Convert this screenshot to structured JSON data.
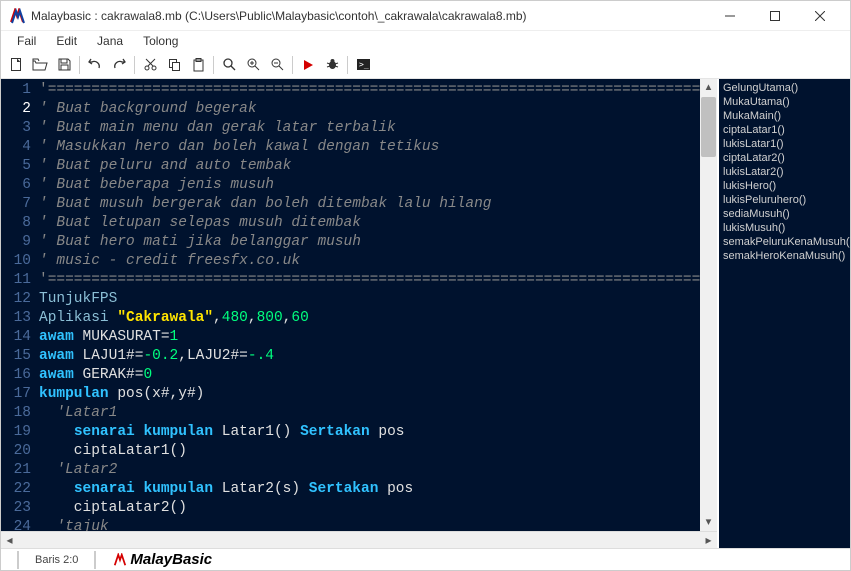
{
  "window": {
    "title": "Malaybasic :  cakrawala8.mb  (C:\\Users\\Public\\Malaybasic\\contoh\\_cakrawala\\cakrawala8.mb)"
  },
  "menu": {
    "items": [
      "Fail",
      "Edit",
      "Jana",
      "Tolong"
    ]
  },
  "toolbar": {
    "groups": [
      [
        "new-file",
        "open-file",
        "save-file"
      ],
      [
        "undo",
        "redo"
      ],
      [
        "cut",
        "copy",
        "paste"
      ],
      [
        "find",
        "zoom-in",
        "zoom-out"
      ],
      [
        "run",
        "debug"
      ],
      [
        "terminal"
      ]
    ]
  },
  "code": {
    "lines": [
      {
        "tokens": [
          {
            "t": "cm-comment-sep",
            "v": "'============================================================================"
          }
        ]
      },
      {
        "tokens": [
          {
            "t": "cm-comment",
            "v": "' Buat background begerak"
          }
        ]
      },
      {
        "tokens": [
          {
            "t": "cm-comment",
            "v": "' Buat main menu dan gerak latar terbalik"
          }
        ]
      },
      {
        "tokens": [
          {
            "t": "cm-comment",
            "v": "' Masukkan hero dan boleh kawal dengan tetikus"
          }
        ]
      },
      {
        "tokens": [
          {
            "t": "cm-comment",
            "v": "' Buat peluru and auto tembak"
          }
        ]
      },
      {
        "tokens": [
          {
            "t": "cm-comment",
            "v": "' Buat beberapa jenis musuh"
          }
        ]
      },
      {
        "tokens": [
          {
            "t": "cm-comment",
            "v": "' Buat musuh bergerak dan boleh ditembak lalu hilang"
          }
        ]
      },
      {
        "tokens": [
          {
            "t": "cm-comment",
            "v": "' Buat letupan selepas musuh ditembak"
          }
        ]
      },
      {
        "tokens": [
          {
            "t": "cm-comment",
            "v": "' Buat hero mati jika belanggar musuh"
          }
        ]
      },
      {
        "tokens": [
          {
            "t": "cm-comment",
            "v": "' music - credit freesfx.co.uk"
          }
        ]
      },
      {
        "tokens": [
          {
            "t": "cm-comment-sep",
            "v": "'============================================================================"
          }
        ]
      },
      {
        "tokens": [
          {
            "t": "cm-pale",
            "v": "TunjukFPS"
          }
        ]
      },
      {
        "tokens": [
          {
            "t": "cm-pale",
            "v": "Aplikasi "
          },
          {
            "t": "cm-string",
            "v": "\"Cakrawala\""
          },
          {
            "t": "cm-ident",
            "v": ","
          },
          {
            "t": "cm-number",
            "v": "480"
          },
          {
            "t": "cm-ident",
            "v": ","
          },
          {
            "t": "cm-number",
            "v": "800"
          },
          {
            "t": "cm-ident",
            "v": ","
          },
          {
            "t": "cm-number",
            "v": "60"
          }
        ]
      },
      {
        "tokens": [
          {
            "t": "cm-keyword",
            "v": "awam"
          },
          {
            "t": "cm-ident",
            "v": " MUKASURAT"
          },
          {
            "t": "cm-op",
            "v": "="
          },
          {
            "t": "cm-number",
            "v": "1"
          }
        ]
      },
      {
        "tokens": [
          {
            "t": "cm-keyword",
            "v": "awam"
          },
          {
            "t": "cm-ident",
            "v": " LAJU1#"
          },
          {
            "t": "cm-op",
            "v": "="
          },
          {
            "t": "cm-number",
            "v": "-0.2"
          },
          {
            "t": "cm-ident",
            "v": ",LAJU2#"
          },
          {
            "t": "cm-op",
            "v": "="
          },
          {
            "t": "cm-number",
            "v": "-.4"
          }
        ]
      },
      {
        "tokens": [
          {
            "t": "cm-keyword",
            "v": "awam"
          },
          {
            "t": "cm-ident",
            "v": " GERAK#"
          },
          {
            "t": "cm-op",
            "v": "="
          },
          {
            "t": "cm-number",
            "v": "0"
          }
        ]
      },
      {
        "tokens": [
          {
            "t": "cm-keyword",
            "v": "kumpulan"
          },
          {
            "t": "cm-ident",
            "v": " pos(x#,y#)"
          }
        ]
      },
      {
        "tokens": [
          {
            "t": "cm-ident",
            "v": "  "
          },
          {
            "t": "cm-comment",
            "v": "'Latar1"
          }
        ]
      },
      {
        "tokens": [
          {
            "t": "cm-ident",
            "v": "    "
          },
          {
            "t": "cm-keyword",
            "v": "senarai"
          },
          {
            "t": "cm-ident",
            "v": " "
          },
          {
            "t": "cm-keyword",
            "v": "kumpulan"
          },
          {
            "t": "cm-ident",
            "v": " Latar1() "
          },
          {
            "t": "cm-keyword",
            "v": "Sertakan"
          },
          {
            "t": "cm-ident",
            "v": " pos"
          }
        ]
      },
      {
        "tokens": [
          {
            "t": "cm-ident",
            "v": "    ciptaLatar1()"
          }
        ]
      },
      {
        "tokens": [
          {
            "t": "cm-ident",
            "v": "  "
          },
          {
            "t": "cm-comment",
            "v": "'Latar2"
          }
        ]
      },
      {
        "tokens": [
          {
            "t": "cm-ident",
            "v": "    "
          },
          {
            "t": "cm-keyword",
            "v": "senarai"
          },
          {
            "t": "cm-ident",
            "v": " "
          },
          {
            "t": "cm-keyword",
            "v": "kumpulan"
          },
          {
            "t": "cm-ident",
            "v": " Latar2(s) "
          },
          {
            "t": "cm-keyword",
            "v": "Sertakan"
          },
          {
            "t": "cm-ident",
            "v": " pos"
          }
        ]
      },
      {
        "tokens": [
          {
            "t": "cm-ident",
            "v": "    ciptaLatar2()"
          }
        ]
      },
      {
        "tokens": [
          {
            "t": "cm-ident",
            "v": "  "
          },
          {
            "t": "cm-comment",
            "v": "'tajuk"
          }
        ]
      }
    ]
  },
  "outline": {
    "items": [
      "GelungUtama()",
      "MukaUtama()",
      "MukaMain()",
      "ciptaLatar1()",
      "lukisLatar1()",
      "ciptaLatar2()",
      "lukisLatar2()",
      "lukisHero()",
      "lukisPeluruhero()",
      "sediaMusuh()",
      "lukisMusuh()",
      "semakPeluruKenaMusuh()",
      "semakHeroKenaMusuh()"
    ]
  },
  "status": {
    "pos": "Baris 2:0",
    "brand": "MalayBasic"
  },
  "icons": {
    "new-file": "🗎",
    "open-file": "📂",
    "save-file": "💾",
    "undo": "↶",
    "redo": "↷",
    "cut": "✂",
    "copy": "⧉",
    "paste": "📋",
    "find": "🔍",
    "zoom-in": "🔍₊",
    "zoom-out": "🔍₋",
    "run": "▶",
    "debug": "🐞",
    "terminal": "▣"
  }
}
